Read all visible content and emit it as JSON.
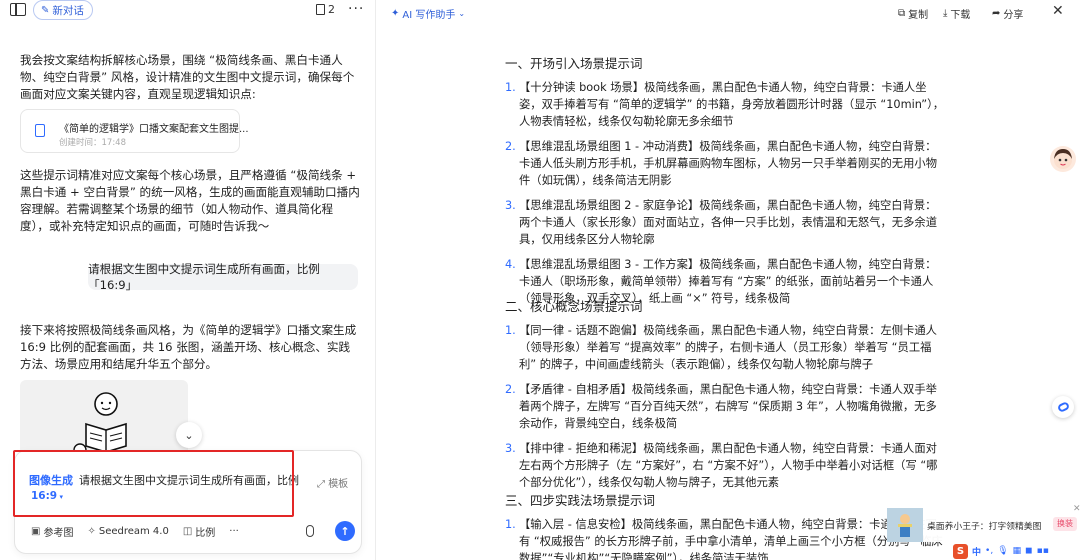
{
  "left": {
    "new_chat_label": "新对话",
    "doc_count": "2",
    "intro_paragraph": "我会按文案结构拆解核心场景，围绕 “极简线条画、黑白卡通人物、纯空白背景” 风格，设计精准的文生图中文提示词，确保每个画面对应文案关键内容，直观呈现逻辑知识点:",
    "file_card": {
      "title": "《简单的逻辑学》口播文案配套文生图提...",
      "date": "创建时间：17:48"
    },
    "summary_paragraph": "这些提示词精准对应文案每个核心场景，且严格遵循 “极简线条 + 黑白卡通 + 空白背景” 的统一风格，生成的画面能直观辅助口播内容理解。若需调整某个场景的细节（如人物动作、道具简化程度），或补充特定知识点的画面，可随时告诉我～",
    "user_message": "请根据文生图中文提示词生成所有画面，比例 「16:9」",
    "reply_paragraph": "接下来将按照极简线条画风格，为《简单的逻辑学》口播文案生成 16:9 比例的配套画面，共 16 张图，涵盖开场、核心概念、实践方法、场景应用和结尾升华五个部分。",
    "composer": {
      "mode_label": "图像生成",
      "input_text": "请根据文生图中文提示词生成所有画面，比例",
      "ratio_label": "16:9",
      "template_label": "模板",
      "tools": [
        {
          "icon": "image-icon",
          "label": "参考图"
        },
        {
          "icon": "sparkle-icon",
          "label": "Seedream 4.0"
        },
        {
          "icon": "ratio-icon",
          "label": "比例"
        }
      ],
      "more_label": "···"
    }
  },
  "right": {
    "header": {
      "title": "AI 写作助手",
      "copy_label": "复制",
      "download_label": "下载",
      "share_label": "分享"
    },
    "sections": [
      {
        "heading": "一、开场引入场景提示词",
        "items": [
          "【十分钟读 book 场景】极简线条画，黑白配色卡通人物，纯空白背景：卡通人坐姿，双手捧着写有 “简单的逻辑学” 的书籍，身旁放着圆形计时器（显示 “10min”），人物表情轻松，线条仅勾勒轮廓无多余细节",
          "【思维混乱场景组图 1 - 冲动消费】极简线条画，黑白配色卡通人物，纯空白背景：卡通人低头刷方形手机，手机屏幕画购物车图标，人物另一只手举着刚买的无用小物件（如玩偶），线条简洁无阴影",
          "【思维混乱场景组图 2 - 家庭争论】极简线条画，黑白配色卡通人物，纯空白背景：两个卡通人（家长形象）面对面站立，各伸一只手比划，表情温和无怒气，无多余道具，仅用线条区分人物轮廓",
          "【思维混乱场景组图 3 - 工作方案】极简线条画，黑白配色卡通人物，纯空白背景：卡通人（职场形象，戴简单领带）捧着写有 “方案” 的纸张，面前站着另一个卡通人（领导形象，双手交叉），纸上画 “×” 符号，线条极简"
        ]
      },
      {
        "heading": "二、核心概念场景提示词",
        "items": [
          "【同一律 - 话题不跑偏】极简线条画，黑白配色卡通人物，纯空白背景：左侧卡通人（领导形象）举着写 “提高效率” 的牌子，右侧卡通人（员工形象）举着写 “员工福利” 的牌子，中间画虚线箭头（表示跑偏），线条仅勾勒人物轮廓与牌子",
          "【矛盾律 - 自相矛盾】极简线条画，黑白配色卡通人物，纯空白背景：卡通人双手举着两个牌子，左牌写 “百分百纯天然”，右牌写 “保质期 3 年”，人物嘴角微撇，无多余动作，背景纯空白，线条极简",
          "【排中律 - 拒绝和稀泥】极简线条画，黑白配色卡通人物，纯空白背景：卡通人面对左右两个方形牌子（左 “方案好”，右 “方案不好”），人物手中举着小对话框（写 “哪个部分优化”），线条仅勾勒人物与牌子，无其他元素"
        ]
      },
      {
        "heading": "三、四步实践法场景提示词",
        "items": [
          "【输入层 - 信息安检】极简线条画，黑白配色卡通人物，纯空白背景：卡通人站在写有 “权威报告” 的长方形牌子前，手中拿小清单，清单上画三个小方框（分别写 “临床数据”“专业机构”“无隐瞒案例”），线条简洁无装饰"
        ]
      }
    ],
    "ad": {
      "text": "桌面养小王子：打字领精美图",
      "button_label": "换装"
    },
    "ime": {
      "logo": "S",
      "lang": "中"
    }
  }
}
